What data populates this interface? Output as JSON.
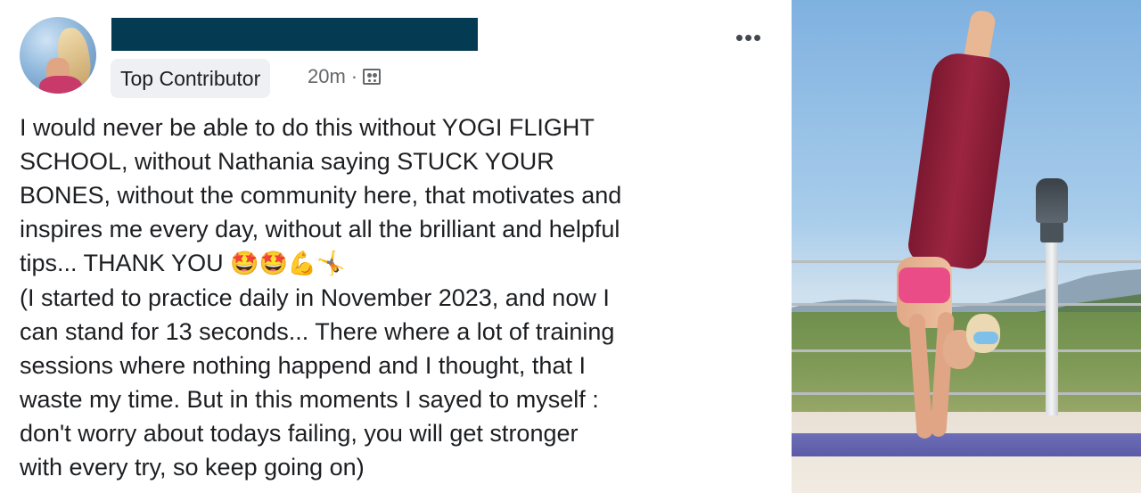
{
  "post": {
    "author_badge": "Top Contributor",
    "timestamp": "20m",
    "separator": "·",
    "audience_icon": "group-icon",
    "more_label": "•••",
    "text_lines": [
      "I would never be able to do this without YOGI FLIGHT",
      "SCHOOL, without Nathania saying STUCK YOUR",
      "BONES, without the community here, that motivates and",
      "inspires me every day, without all the brilliant and helpful",
      "tips... THANK YOU",
      "(I started to practice daily in November 2023, and now I",
      "can stand for 13 seconds... There where a lot of training",
      "sessions where nothing happend and I thought, that I",
      "waste my time. But in this moments I sayed to myself :",
      "don't worry about todays failing, you will get stronger",
      "with every try, so keep going on)"
    ],
    "emojis": "🤩🤩💪🤸"
  },
  "colors": {
    "redaction": "#043a52",
    "badge_bg": "#eef0f3",
    "text": "#1c1e21",
    "meta": "#65676b"
  }
}
